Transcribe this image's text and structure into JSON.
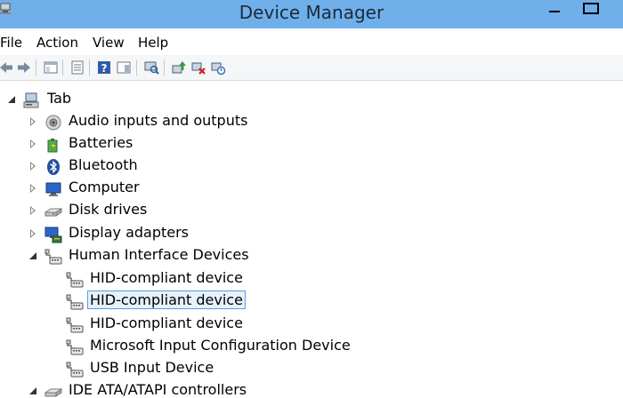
{
  "window": {
    "title": "Device Manager"
  },
  "menu": {
    "file": "File",
    "action": "Action",
    "view": "View",
    "help": "Help"
  },
  "toolbar": {
    "buttons": [
      "back-icon",
      "forward-icon",
      "show-hide-console-tree-icon",
      "properties-icon",
      "help-icon",
      "action-pane-icon",
      "scan-hardware-icon",
      "update-driver-icon",
      "uninstall-icon",
      "disable-icon"
    ]
  },
  "tree": {
    "root": {
      "label": "Tab",
      "icon": "computer-icon",
      "expanded": true
    },
    "categories": [
      {
        "label": "Audio inputs and outputs",
        "icon": "speaker-icon",
        "expanded": false
      },
      {
        "label": "Batteries",
        "icon": "battery-icon",
        "expanded": false
      },
      {
        "label": "Bluetooth",
        "icon": "bluetooth-icon",
        "expanded": false
      },
      {
        "label": "Computer",
        "icon": "monitor-icon",
        "expanded": false
      },
      {
        "label": "Disk drives",
        "icon": "disk-drive-icon",
        "expanded": false
      },
      {
        "label": "Display adapters",
        "icon": "display-adapter-icon",
        "expanded": false
      },
      {
        "label": "Human Interface Devices",
        "icon": "hid-icon",
        "expanded": true,
        "children": [
          {
            "label": "HID-compliant device",
            "icon": "hid-icon",
            "selected": false
          },
          {
            "label": "HID-compliant device",
            "icon": "hid-icon",
            "selected": true
          },
          {
            "label": "HID-compliant device",
            "icon": "hid-icon",
            "selected": false
          },
          {
            "label": "Microsoft Input Configuration Device",
            "icon": "hid-icon",
            "selected": false
          },
          {
            "label": "USB Input Device",
            "icon": "hid-icon",
            "selected": false
          }
        ]
      },
      {
        "label": "IDE ATA/ATAPI controllers",
        "icon": "ide-controller-icon",
        "expanded": false
      }
    ]
  },
  "colors": {
    "titlebar": "#6fb0ea",
    "selection_border": "#5b9bd5",
    "selection_fill": "#e5f1fb"
  }
}
